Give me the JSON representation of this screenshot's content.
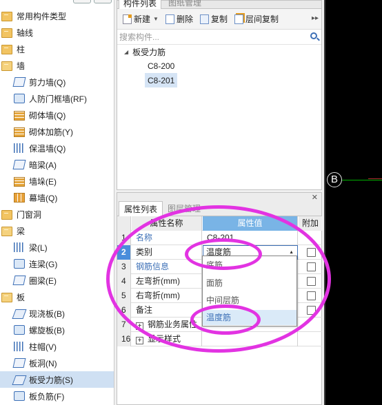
{
  "tree": {
    "items": [
      {
        "type": "cat",
        "label": "常用构件类型",
        "icon": "folder-icon"
      },
      {
        "type": "cat",
        "label": "轴线",
        "icon": "folder-icon"
      },
      {
        "type": "cat",
        "label": "柱",
        "icon": "folder-icon"
      },
      {
        "type": "cat",
        "label": "墙",
        "icon": "folder-open-icon"
      },
      {
        "type": "sub",
        "label": "剪力墙(Q)",
        "icon": "shear-wall-icon"
      },
      {
        "type": "sub",
        "label": "人防门框墙(RF)",
        "icon": "door-frame-wall-icon"
      },
      {
        "type": "sub",
        "label": "砌体墙(Q)",
        "icon": "masonry-wall-icon"
      },
      {
        "type": "sub",
        "label": "砌体加筋(Y)",
        "icon": "masonry-rebar-icon"
      },
      {
        "type": "sub",
        "label": "保温墙(Q)",
        "icon": "insulation-wall-icon"
      },
      {
        "type": "sub",
        "label": "暗梁(A)",
        "icon": "hidden-beam-icon"
      },
      {
        "type": "sub",
        "label": "墙垛(E)",
        "icon": "wall-pier-icon"
      },
      {
        "type": "sub",
        "label": "幕墙(Q)",
        "icon": "curtain-wall-icon"
      },
      {
        "type": "cat",
        "label": "门窗洞",
        "icon": "folder-icon"
      },
      {
        "type": "cat",
        "label": "梁",
        "icon": "folder-open-icon"
      },
      {
        "type": "sub",
        "label": "梁(L)",
        "icon": "beam-icon"
      },
      {
        "type": "sub",
        "label": "连梁(G)",
        "icon": "coupling-beam-icon"
      },
      {
        "type": "sub",
        "label": "圈梁(E)",
        "icon": "ring-beam-icon"
      },
      {
        "type": "cat",
        "label": "板",
        "icon": "folder-open-icon"
      },
      {
        "type": "sub",
        "label": "现浇板(B)",
        "icon": "cast-slab-icon"
      },
      {
        "type": "sub",
        "label": "螺旋板(B)",
        "icon": "spiral-slab-icon"
      },
      {
        "type": "sub",
        "label": "柱帽(V)",
        "icon": "column-cap-icon"
      },
      {
        "type": "sub",
        "label": "板洞(N)",
        "icon": "slab-hole-icon"
      },
      {
        "type": "sub",
        "label": "板受力筋(S)",
        "icon": "slab-stress-rebar-icon",
        "selected": true
      },
      {
        "type": "sub",
        "label": "板负筋(F)",
        "icon": "slab-negative-rebar-icon"
      }
    ]
  },
  "component_panel": {
    "tabs": [
      "构件列表",
      "图纸管理"
    ],
    "toolbar": {
      "new_label": "新建",
      "delete_label": "删除",
      "copy_label": "复制",
      "floor_copy_label": "层间复制"
    },
    "search_placeholder": "搜索构件...",
    "tree": {
      "root": "板受力筋",
      "children": [
        "C8-200",
        "C8-201"
      ],
      "selected_index": 1
    }
  },
  "property_panel": {
    "tabs": [
      "属性列表",
      "图层管理"
    ],
    "columns": [
      "属性名称",
      "属性值",
      "附加"
    ],
    "rows": [
      {
        "idx": "1",
        "name": "名称",
        "value": "C8-201",
        "name_blue": true,
        "checkbox": false
      },
      {
        "idx": "2",
        "name": "类别",
        "value": "温度筋",
        "name_blue": false,
        "checkbox": true
      },
      {
        "idx": "3",
        "name": "钢筋信息",
        "value": "",
        "name_blue": true,
        "checkbox": true
      },
      {
        "idx": "4",
        "name": "左弯折(mm)",
        "value": "",
        "name_blue": false,
        "checkbox": true
      },
      {
        "idx": "5",
        "name": "右弯折(mm)",
        "value": "",
        "name_blue": false,
        "checkbox": true
      },
      {
        "idx": "6",
        "name": "备注",
        "value": "",
        "name_blue": false,
        "checkbox": true
      },
      {
        "idx": "7",
        "name": "钢筋业务属性",
        "value": "",
        "name_blue": false,
        "checkbox": false,
        "expander": true
      },
      {
        "idx": "16",
        "name": "显示样式",
        "value": "",
        "name_blue": false,
        "checkbox": false,
        "expander": true
      }
    ],
    "category_dropdown": {
      "options": [
        "底筋",
        "面筋",
        "中间层筋",
        "温度筋"
      ],
      "highlighted_index": 3
    }
  },
  "canvas": {
    "axis_label": "B",
    "axis_color": "#00b000",
    "bg_color": "#000000"
  },
  "annotation_color": "#e233e2"
}
